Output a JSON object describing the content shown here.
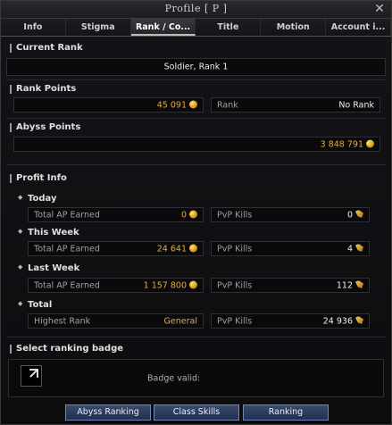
{
  "window": {
    "title": "Profile [ P ]"
  },
  "tabs": [
    {
      "label": "Info"
    },
    {
      "label": "Stigma"
    },
    {
      "label": "Rank / Co..."
    },
    {
      "label": "Title"
    },
    {
      "label": "Motion"
    },
    {
      "label": "Account i..."
    }
  ],
  "current_rank": {
    "heading": "Current Rank",
    "value": "Soldier, Rank 1"
  },
  "rank_points": {
    "heading": "Rank Points",
    "value": "45 091",
    "rank_label": "Rank",
    "rank_value": "No Rank"
  },
  "abyss_points": {
    "heading": "Abyss Points",
    "value": "3 848 791"
  },
  "profit": {
    "heading": "Profit Info",
    "today": {
      "label": "Today",
      "ap_label": "Total AP Earned",
      "ap": "0",
      "kills_label": "PvP Kills",
      "kills": "0"
    },
    "week": {
      "label": "This Week",
      "ap_label": "Total AP Earned",
      "ap": "24 641",
      "kills_label": "PvP Kills",
      "kills": "4"
    },
    "last_week": {
      "label": "Last Week",
      "ap_label": "Total AP Earned",
      "ap": "1 157 800",
      "kills_label": "PvP Kills",
      "kills": "112"
    },
    "total": {
      "label": "Total",
      "rank_label": "Highest Rank",
      "rank": "General",
      "kills_label": "PvP Kills",
      "kills": "24 936"
    }
  },
  "badge": {
    "heading": "Select ranking badge",
    "valid_label": "Badge valid:"
  },
  "buttons": {
    "abyss": "Abyss Ranking",
    "class_skills": "Class Skills",
    "ranking": "Ranking"
  }
}
